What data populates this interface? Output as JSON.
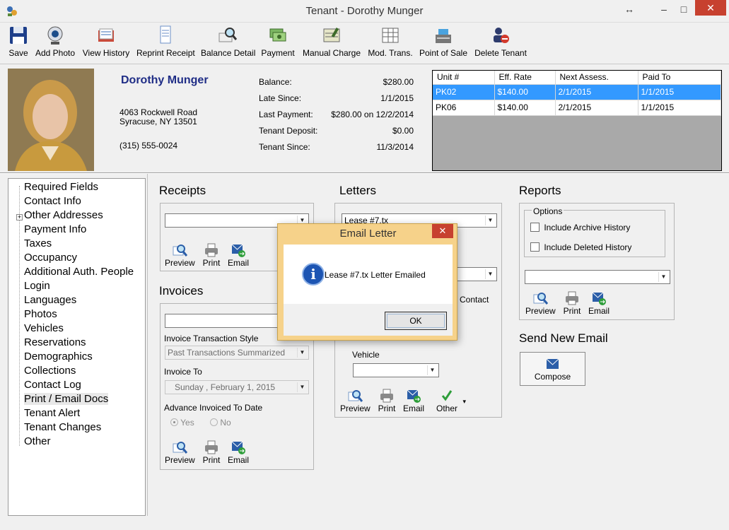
{
  "window": {
    "title": "Tenant - Dorothy Munger",
    "resize_glyph": "↔",
    "minimize_glyph": "–",
    "maximize_glyph": "□",
    "close_glyph": "✕"
  },
  "toolbar": {
    "save": "Save",
    "add_photo": "Add Photo",
    "view_history": "View History",
    "reprint_receipt": "Reprint Receipt",
    "balance_detail": "Balance Detail",
    "payment": "Payment",
    "manual_charge": "Manual Charge",
    "mod_trans": "Mod. Trans.",
    "point_of_sale": "Point of Sale",
    "delete_tenant": "Delete Tenant"
  },
  "tenant": {
    "name": "Dorothy Munger",
    "address_line1": "4063 Rockwell Road",
    "address_line2": "Syracuse, NY  13501",
    "phone": "(315) 555-0024"
  },
  "account": {
    "balance_label": "Balance:",
    "balance": "$280.00",
    "late_since_label": "Late Since:",
    "late_since": "1/1/2015",
    "last_payment_label": "Last Payment:",
    "last_payment": "$280.00 on 12/2/2014",
    "deposit_label": "Tenant Deposit:",
    "deposit": "$0.00",
    "tenant_since_label": "Tenant Since:",
    "tenant_since": "11/3/2014"
  },
  "units": {
    "headers": [
      "Unit #",
      "Eff. Rate",
      "Next Assess.",
      "Paid To"
    ],
    "rows": [
      [
        "PK02",
        "$140.00",
        "2/1/2015",
        "1/1/2015"
      ],
      [
        "PK06",
        "$140.00",
        "2/1/2015",
        "1/1/2015"
      ]
    ]
  },
  "nav": {
    "items": [
      "Required Fields",
      "Contact Info",
      "Other Addresses",
      "Payment Info",
      "Taxes",
      "Occupancy",
      "Additional Auth. People",
      "Login",
      "Languages",
      "Photos",
      "Vehicles",
      "Reservations",
      "Demographics",
      "Collections",
      "Contact Log",
      "Print / Email Docs",
      "Tenant Alert",
      "Tenant Changes",
      "Other"
    ],
    "expander": "+"
  },
  "receipts": {
    "title": "Receipts",
    "select_value": "",
    "preview": "Preview",
    "print": "Print",
    "email": "Email"
  },
  "invoices": {
    "title": "Invoices",
    "select_value": "",
    "style_label": "Invoice Transaction Style",
    "style_value": "Past Transactions Summarized",
    "invoice_to_label": "Invoice To",
    "invoice_to_value": "Sunday    ,   February     1, 2015",
    "advance_label": "Advance Invoiced To Date",
    "yes": "Yes",
    "no": "No",
    "preview": "Preview",
    "print": "Print",
    "email": "Email"
  },
  "letters": {
    "title": "Letters",
    "select_value": "Lease #7.tx",
    "partial_label": "e Contact",
    "vehicle_label": "Vehicle",
    "vehicle_value": "",
    "preview": "Preview",
    "print": "Print",
    "email": "Email",
    "other": "Other",
    "other_arrow": "▾"
  },
  "reports": {
    "title": "Reports",
    "options_label": "Options",
    "include_archive": "Include Archive History",
    "include_deleted": "Include Deleted History",
    "select_value": "",
    "preview": "Preview",
    "print": "Print",
    "email": "Email"
  },
  "send_email": {
    "title": "Send New Email",
    "compose": "Compose"
  },
  "dialog": {
    "title": "Email Letter",
    "message": "Lease #7.tx Letter Emailed",
    "ok": "OK",
    "close_glyph": "✕",
    "info_glyph": "i"
  },
  "combo_arrow": "▼",
  "colors": {
    "selection": "#3399ff",
    "accent_name": "#1f2d86",
    "dialog_frame": "#f6d28a",
    "close_red": "#c7412f"
  }
}
